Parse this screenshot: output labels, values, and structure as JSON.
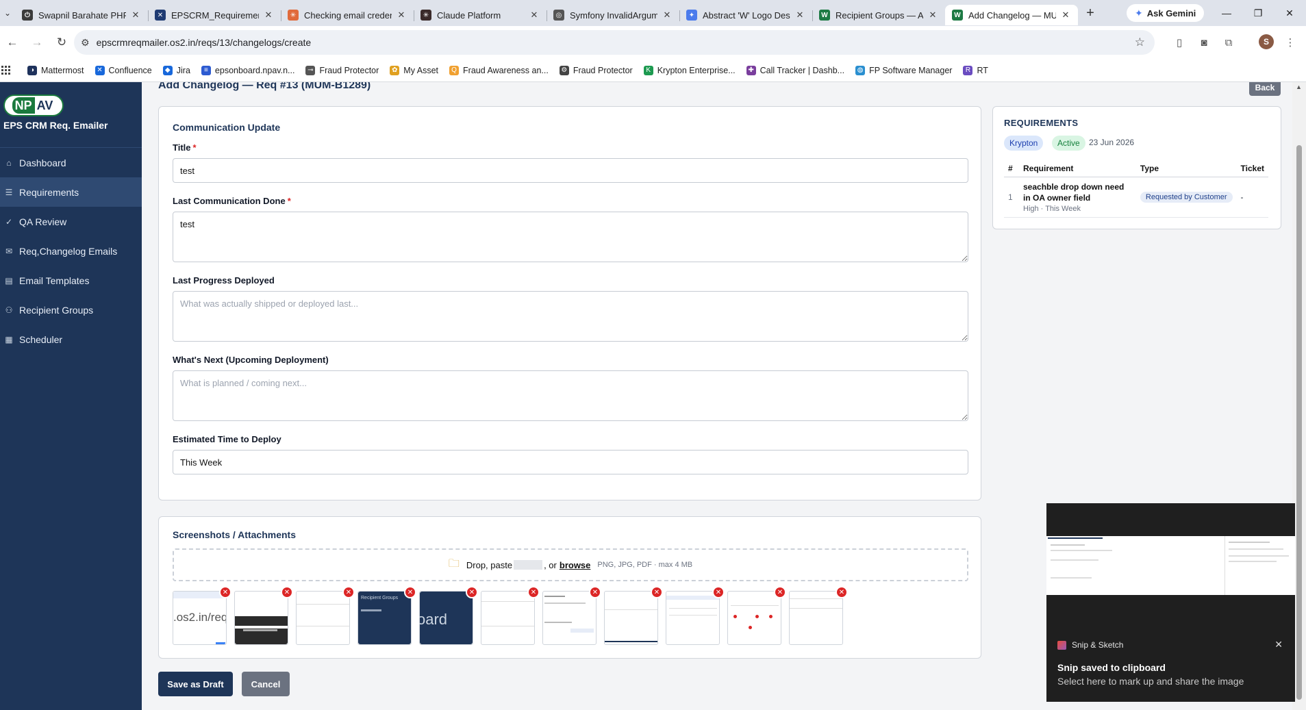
{
  "browser": {
    "tabs": [
      {
        "title": "Swapnil Barahate PHP",
        "color": "#3b3b3b",
        "glyph": "⏻"
      },
      {
        "title": "EPSCRM_Requirement",
        "color": "#1f3b73",
        "glyph": "✕"
      },
      {
        "title": "Checking email creden",
        "color": "#e06a3b",
        "glyph": "✳"
      },
      {
        "title": "Claude Platform",
        "color": "#3a2a2a",
        "glyph": "✳"
      },
      {
        "title": "Symfony InvalidArgum",
        "color": "#555555",
        "glyph": "◎"
      },
      {
        "title": "Abstract 'W' Logo Des",
        "color": "#4b7bec",
        "glyph": "✦"
      },
      {
        "title": "Recipient Groups — A",
        "color": "#1d7a44",
        "glyph": "W"
      },
      {
        "title": "Add Changelog — MU",
        "color": "#1d7a44",
        "glyph": "W"
      }
    ],
    "ask_gemini": "Ask Gemini",
    "url": "epscrmreqmailer.os2.in/reqs/13/changelogs/create",
    "bookmarks": [
      {
        "label": "Mattermost",
        "color": "#1e325c",
        "glyph": "◑"
      },
      {
        "label": "Confluence",
        "color": "#1868db",
        "glyph": "✕"
      },
      {
        "label": "Jira",
        "color": "#1868db",
        "glyph": "◆"
      },
      {
        "label": "epsonboard.npav.n...",
        "color": "#2d5bd1",
        "glyph": "≡"
      },
      {
        "label": "Fraud Protector",
        "color": "#555555",
        "glyph": "⊸"
      },
      {
        "label": "My Asset",
        "color": "#e0a020",
        "glyph": "✿"
      },
      {
        "label": "Fraud Awareness an...",
        "color": "#f0a030",
        "glyph": "Q"
      },
      {
        "label": "Fraud Protector",
        "color": "#444444",
        "glyph": "⚙"
      },
      {
        "label": "Krypton Enterprise...",
        "color": "#1d9a50",
        "glyph": "K"
      },
      {
        "label": "Call Tracker | Dashb...",
        "color": "#7a3e9d",
        "glyph": "✚"
      },
      {
        "label": "FP Software Manager",
        "color": "#2a8fd0",
        "glyph": "◍"
      },
      {
        "label": "RT",
        "color": "#6a4cc0",
        "glyph": "R"
      }
    ],
    "profile_initial": "S"
  },
  "sidebar": {
    "logo_np": "NP",
    "logo_av": "AV",
    "brand": "EPS CRM Req. Emailer",
    "items": [
      {
        "label": "Dashboard",
        "icon": "⌂"
      },
      {
        "label": "Requirements",
        "icon": "☰"
      },
      {
        "label": "QA Review",
        "icon": "✓"
      },
      {
        "label": "Req,Changelog Emails",
        "icon": "✉"
      },
      {
        "label": "Email Templates",
        "icon": "▤"
      },
      {
        "label": "Recipient Groups",
        "icon": "⚇"
      },
      {
        "label": "Scheduler",
        "icon": "▦"
      }
    ]
  },
  "page": {
    "title": "Add Changelog — Req #13 (MUM-B1289)",
    "back": "Back"
  },
  "form": {
    "section_title": "Communication Update",
    "title_label": "Title",
    "title_value": "test",
    "last_comm_label": "Last Communication Done",
    "last_comm_value": "test",
    "last_progress_label": "Last Progress Deployed",
    "last_progress_placeholder": "What was actually shipped or deployed last...",
    "whats_next_label": "What's Next (Upcoming Deployment)",
    "whats_next_placeholder": "What is planned / coming next...",
    "eta_label": "Estimated Time to Deploy",
    "eta_value": "This Week",
    "required_mark": "*"
  },
  "attachments": {
    "title": "Screenshots / Attachments",
    "drop_text": "Drop, paste",
    "or_text": ", or",
    "browse": "browse",
    "hint": "PNG, JPG, PDF · max 4 MB",
    "thumb_texts": [
      ".os2.in/req",
      "",
      "",
      "Recipient Groups",
      "oard",
      "",
      "",
      "",
      "",
      "",
      ""
    ]
  },
  "actions": {
    "save_draft": "Save as Draft",
    "cancel": "Cancel"
  },
  "requirements_panel": {
    "title": "REQUIREMENTS",
    "chip_product": "Krypton",
    "chip_status": "Active",
    "date": "23 Jun 2026",
    "headers": [
      "#",
      "Requirement",
      "Type",
      "Ticket"
    ],
    "rows": [
      {
        "num": "1",
        "requirement": "seachble drop down need in OA owner field",
        "meta": "High · This Week",
        "type": "Requested by Customer",
        "ticket": "-"
      }
    ]
  },
  "toast": {
    "app": "Snip & Sketch",
    "title": "Snip saved to clipboard",
    "body": "Select here to mark up and share the image"
  },
  "colors": {
    "sidebar_bg": "#1e3558",
    "primary": "#1e3558",
    "danger": "#dc2626",
    "status_active_bg": "#d9f5e3",
    "status_active_fg": "#15803d",
    "chip_product_bg": "#dbe7fb",
    "chip_product_fg": "#1e40af"
  }
}
